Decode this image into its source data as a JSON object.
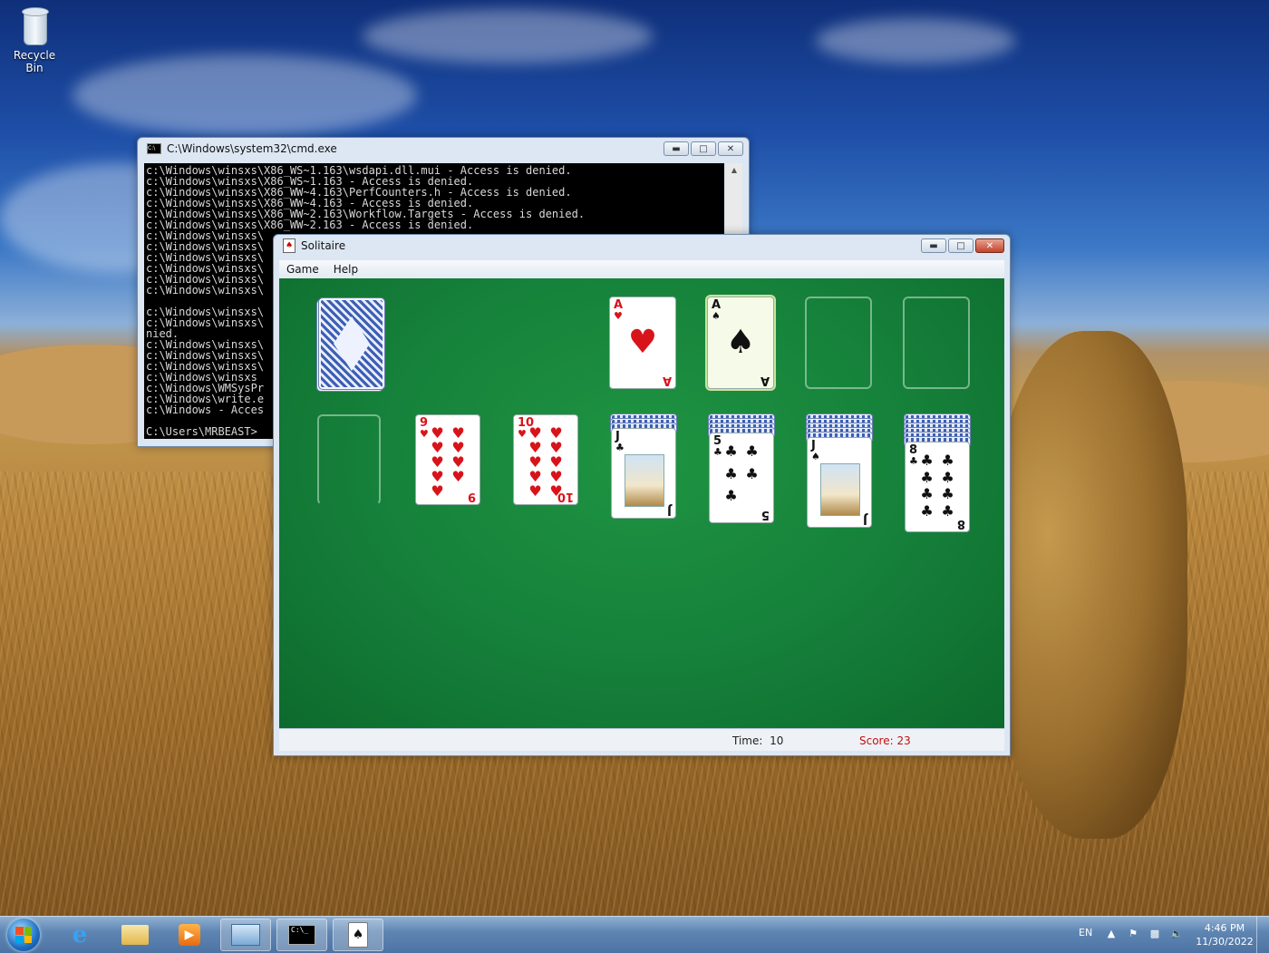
{
  "desktop": {
    "icons": [
      {
        "label": "Recycle Bin",
        "icon": "recycle-bin-icon"
      }
    ]
  },
  "cmd_window": {
    "title": "C:\\Windows\\system32\\cmd.exe",
    "lines": [
      "c:\\Windows\\winsxs\\X86_WS~1.163\\wsdapi.dll.mui - Access is denied.",
      "c:\\Windows\\winsxs\\X86_WS~1.163 - Access is denied.",
      "c:\\Windows\\winsxs\\X86_WW~4.163\\PerfCounters.h - Access is denied.",
      "c:\\Windows\\winsxs\\X86_WW~4.163 - Access is denied.",
      "c:\\Windows\\winsxs\\X86_WW~2.163\\Workflow.Targets - Access is denied.",
      "c:\\Windows\\winsxs\\X86_WW~2.163 - Access is denied.",
      "c:\\Windows\\winsxs\\",
      "c:\\Windows\\winsxs\\",
      "c:\\Windows\\winsxs\\",
      "c:\\Windows\\winsxs\\",
      "c:\\Windows\\winsxs\\",
      "c:\\Windows\\winsxs\\",
      "",
      "c:\\Windows\\winsxs\\",
      "c:\\Windows\\winsxs\\",
      "nied.",
      "c:\\Windows\\winsxs\\",
      "c:\\Windows\\winsxs\\",
      "c:\\Windows\\winsxs\\",
      "c:\\Windows\\winsxs",
      "c:\\Windows\\WMSysPr",
      "c:\\Windows\\write.e",
      "c:\\Windows - Acces",
      "",
      "C:\\Users\\MRBEAST>"
    ]
  },
  "solitaire": {
    "title": "Solitaire",
    "menu": [
      "Game",
      "Help"
    ],
    "time_label": "Time:",
    "time_value": "10",
    "score_label": "Score:",
    "score_value": "23",
    "foundation": [
      {
        "rank": "A",
        "suit": "♥",
        "color": "#d8141a"
      },
      {
        "rank": "A",
        "suit": "♠",
        "color": "#111111"
      }
    ],
    "tableau": [
      {
        "rank": "9",
        "suit": "♥",
        "color": "#d8141a",
        "hidden": 0
      },
      {
        "rank": "10",
        "suit": "♥",
        "color": "#d8141a",
        "hidden": 0
      },
      {
        "rank": "J",
        "suit": "♣",
        "color": "#111111",
        "hidden": 3
      },
      {
        "rank": "5",
        "suit": "♣",
        "color": "#111111",
        "hidden": 4
      },
      {
        "rank": "J",
        "suit": "♠",
        "color": "#111111",
        "hidden": 5
      },
      {
        "rank": "8",
        "suit": "♣",
        "color": "#111111",
        "hidden": 6
      }
    ]
  },
  "taskbar": {
    "language": "EN",
    "time": "4:46 PM",
    "date": "11/30/2022",
    "pinned": [
      "internet-explorer-icon",
      "explorer-folder-icon",
      "media-player-icon",
      "control-panel-icon",
      "cmd-icon",
      "solitaire-icon"
    ]
  },
  "colors": {
    "felt": "#15803a",
    "score_red": "#c01010",
    "hearts": "#d8141a"
  }
}
